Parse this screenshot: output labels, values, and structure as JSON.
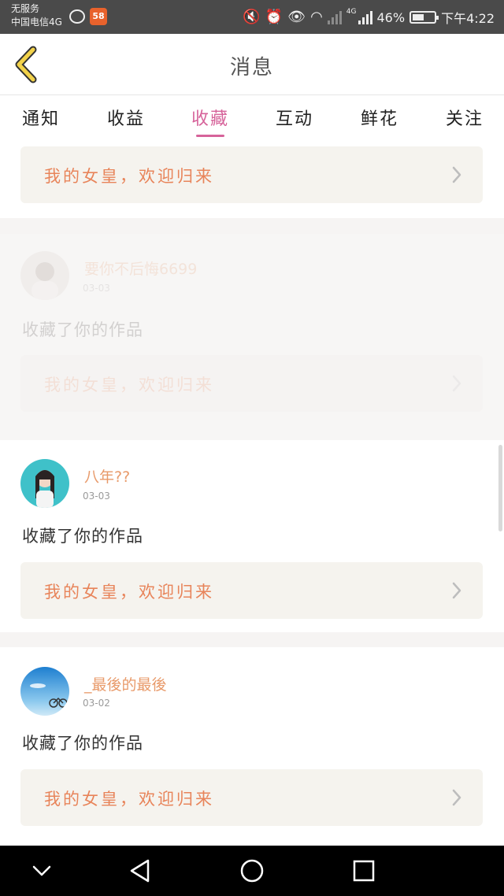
{
  "status_bar": {
    "carrier_line1": "无服务",
    "carrier_line2": "中国电信4G",
    "app_badge": "58",
    "network": "4G",
    "battery": "46%",
    "time": "下午4:22"
  },
  "header": {
    "title": "消息",
    "back_icon": "chevron-left-icon"
  },
  "tabs": [
    {
      "label": "通知",
      "active": false
    },
    {
      "label": "收益",
      "active": false
    },
    {
      "label": "收藏",
      "active": true
    },
    {
      "label": "互动",
      "active": false
    },
    {
      "label": "鲜花",
      "active": false
    },
    {
      "label": "关注",
      "active": false
    }
  ],
  "banner_text": "我的女皇，欢迎归来",
  "items": [
    {
      "username": "要你不后悔6699",
      "date": "03-03",
      "action": "收藏了你的作品",
      "banner": "我的女皇，欢迎归来"
    },
    {
      "username": "八年??",
      "date": "03-03",
      "action": "收藏了你的作品",
      "banner": "我的女皇，欢迎归来"
    },
    {
      "username": "_最後的最後",
      "date": "03-02",
      "action": "收藏了你的作品",
      "banner": "我的女皇，欢迎归来"
    }
  ],
  "colors": {
    "accent_pink": "#d6639a",
    "name_orange": "#e89a6a",
    "banner_text": "#e8845a",
    "back_icon_yellow": "#f2d24a"
  }
}
